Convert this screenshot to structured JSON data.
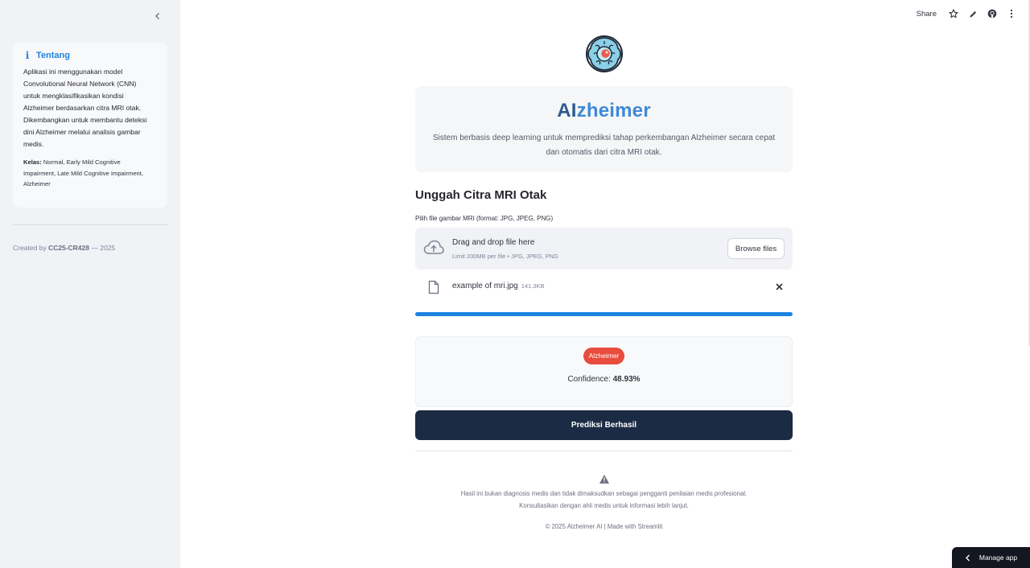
{
  "sidebar": {
    "collapse_icon": "chevron-left-icon",
    "info": {
      "icon": "info-icon",
      "title": "Tentang",
      "lines": [
        "Aplikasi ini menggunakan model",
        "Convolutional Neural Network (CNN)",
        "untuk mengklasifikasikan kondisi",
        "Alzheimer berdasarkan citra MRI otak.",
        "Dikembangkan untuk membantu deteksi",
        "dini Alzheimer melalui analisis gambar",
        "medis."
      ],
      "class_label": "Kelas:",
      "class_lines": [
        "Normal, Early Mild Cognitive",
        "Impairment, Late Mild Cognitive Impairment,",
        "Alzheimer"
      ]
    },
    "created_prefix": "Created by",
    "created_by": "CC25-CR428",
    "created_suffix": "— 2025"
  },
  "toolbar": {
    "share_label": "Share",
    "icons": [
      "star-icon",
      "edit-icon",
      "github-icon",
      "more-vertical-icon"
    ]
  },
  "hero": {
    "title_ai": "AI",
    "title_rest": "zheimer",
    "description_lines": [
      "Sistem berbasis deep learning untuk memprediksi tahap perkembangan Alzheimer secara cepat",
      "dan otomatis dari citra MRI otak."
    ]
  },
  "upload": {
    "section_title": "Unggah Citra MRI Otak",
    "label": "Pilih file gambar MRI (format: JPG, JPEG, PNG)",
    "dropzone_main": "Drag and drop file here",
    "dropzone_sub": "Limit 200MB per file • JPG, JPEG, PNG",
    "browse_label": "Browse files",
    "file": {
      "name": "example of mri.jpg",
      "size": "141.3KB"
    },
    "progress": 1.0
  },
  "result": {
    "badge": "Alzheimer",
    "badge_color": "#e74c3c",
    "confidence_label": "Confidence:",
    "confidence_value": "48.93%"
  },
  "predict_button": "Prediksi Berhasil",
  "footer": {
    "warning_icon": "warning-icon",
    "disclaimer_lines": [
      "Hasil ini bukan diagnosis medis dan tidak dimaksudkan sebagai pengganti penilaian medis profesional.",
      "Konsultasikan dengan ahli medis untuk informasi lebih lanjut."
    ],
    "copyright": "© 2025 Alzheimer AI | Made with Streamlit"
  },
  "manage_app_label": "Manage app",
  "colors": {
    "accent": "#1c83e1",
    "primary_button": "#1b2b44",
    "sidebar_bg": "#f0f2f6"
  }
}
